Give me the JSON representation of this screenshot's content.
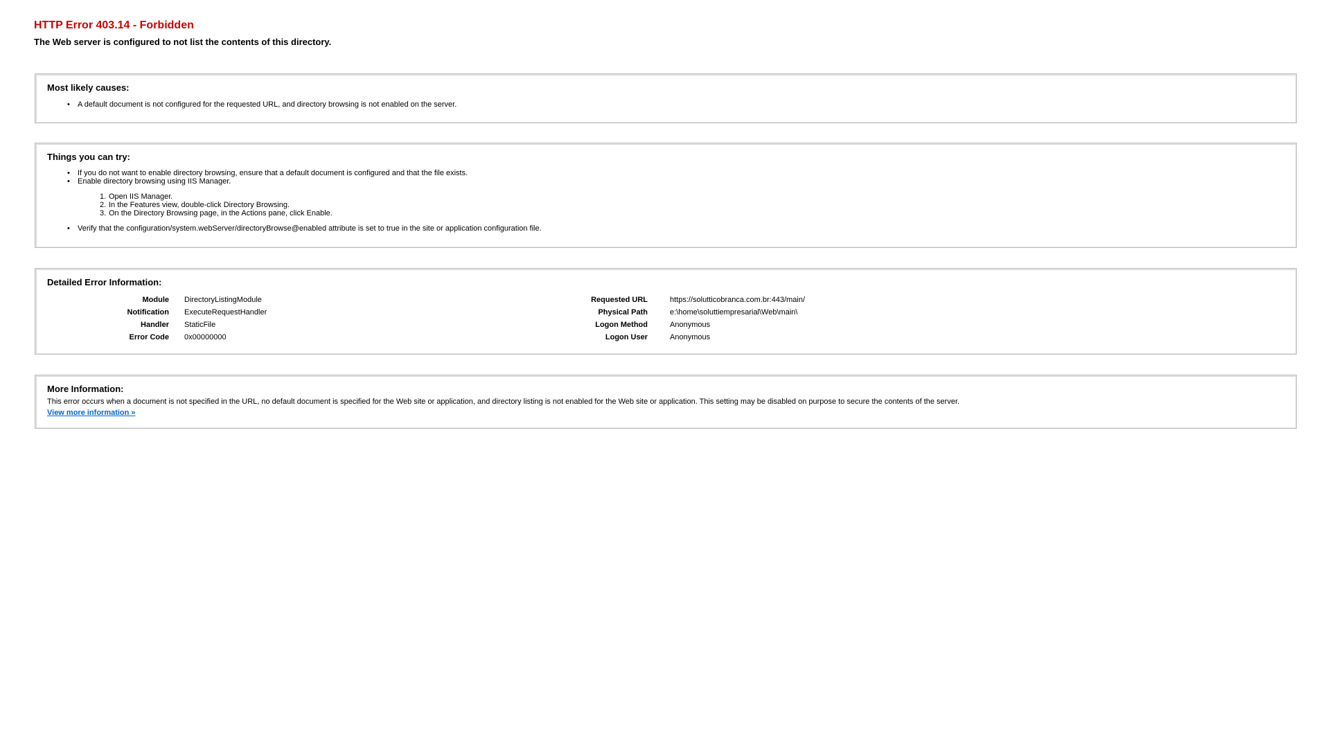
{
  "header": {
    "title": "HTTP Error 403.14 - Forbidden",
    "subtitle": "The Web server is configured to not list the contents of this directory."
  },
  "causes": {
    "title": "Most likely causes:",
    "items": [
      "A default document is not configured for the requested URL, and directory browsing is not enabled on the server."
    ]
  },
  "try": {
    "title": "Things you can try:",
    "items": [
      "If you do not want to enable directory browsing, ensure that a default document is configured and that the file exists.",
      "Enable directory browsing using IIS Manager.",
      "Verify that the configuration/system.webServer/directoryBrowse@enabled attribute is set to true in the site or application configuration file."
    ],
    "steps": [
      {
        "num": "1.",
        "text": "Open IIS Manager."
      },
      {
        "num": "2.",
        "text": "In the Features view, double-click Directory Browsing."
      },
      {
        "num": "3.",
        "text": "On the Directory Browsing page, in the Actions pane, click Enable."
      }
    ]
  },
  "details": {
    "title": "Detailed Error Information:",
    "left": [
      {
        "label": "Module",
        "value": "DirectoryListingModule"
      },
      {
        "label": "Notification",
        "value": "ExecuteRequestHandler"
      },
      {
        "label": "Handler",
        "value": "StaticFile"
      },
      {
        "label": "Error Code",
        "value": "0x00000000"
      }
    ],
    "right": [
      {
        "label": "Requested URL",
        "value": "https://solutticobranca.com.br:443/main/"
      },
      {
        "label": "Physical Path",
        "value": "e:\\home\\soluttiempresarial\\Web\\main\\"
      },
      {
        "label": "Logon Method",
        "value": "Anonymous"
      },
      {
        "label": "Logon User",
        "value": "Anonymous"
      }
    ]
  },
  "more": {
    "title": "More Information:",
    "text": "This error occurs when a document is not specified in the URL, no default document is specified for the Web site or application, and directory listing is not enabled for the Web site or application. This setting may be disabled on purpose to secure the contents of the server.",
    "link_label": "View more information »"
  },
  "colors": {
    "title_red": "#cc0000",
    "link_blue": "#0066cc",
    "box_border": "#bbbbbb"
  }
}
